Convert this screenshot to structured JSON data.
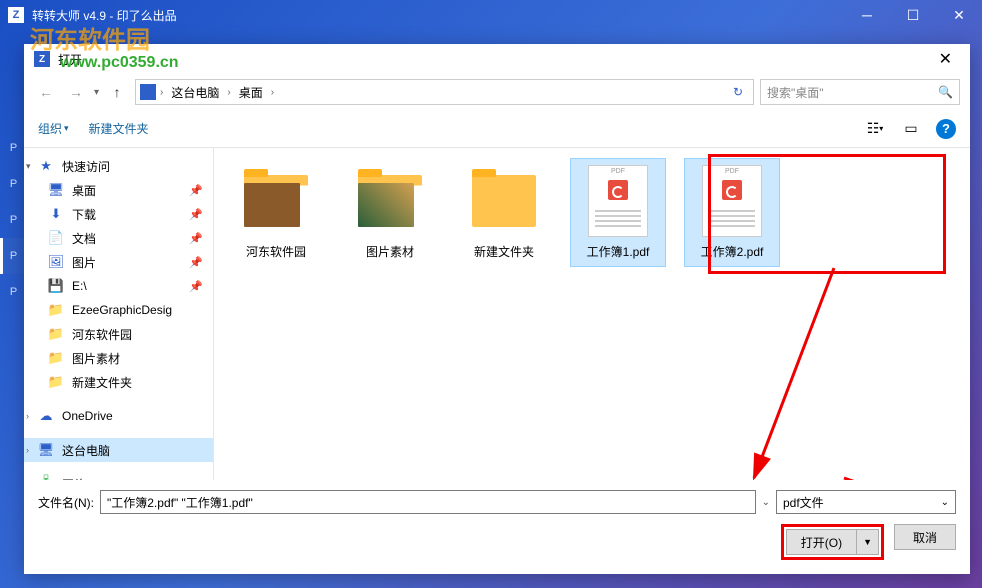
{
  "app": {
    "title": "转转大师 v4.9 - 印了么出品",
    "watermark": "河东软件园",
    "watermark_url": "www.pc0359.cn"
  },
  "left_strip": [
    "P",
    "P",
    "P",
    "P",
    "P"
  ],
  "dialog": {
    "title": "打开",
    "close": "✕",
    "nav": {
      "back": "←",
      "forward": "→",
      "up": "↑"
    },
    "path": {
      "seg1": "这台电脑",
      "seg2": "桌面",
      "refresh": "↻"
    },
    "search": {
      "placeholder": "搜索\"桌面\"",
      "icon": "🔍"
    },
    "toolbar": {
      "organize": "组织",
      "newfolder": "新建文件夹",
      "help": "?"
    },
    "sidebar": {
      "quick": "快速访问",
      "desktop": "桌面",
      "downloads": "下载",
      "documents": "文档",
      "pictures": "图片",
      "e_drive": "E:\\",
      "ezee": "EzeeGraphicDesig",
      "hedong": "河东软件园",
      "picmat": "图片素材",
      "newfolder": "新建文件夹",
      "onedrive": "OneDrive",
      "thispc": "这台电脑",
      "network": "网络"
    },
    "files": [
      {
        "name": "河东软件园",
        "type": "folder-img1"
      },
      {
        "name": "图片素材",
        "type": "folder-img2"
      },
      {
        "name": "新建文件夹",
        "type": "folder"
      },
      {
        "name": "工作簿1.pdf",
        "type": "pdf",
        "selected": true
      },
      {
        "name": "工作簿2.pdf",
        "type": "pdf",
        "selected": true
      }
    ],
    "filename_label": "文件名(N):",
    "filename_value": "\"工作簿2.pdf\" \"工作簿1.pdf\"",
    "filter": "pdf文件",
    "open_btn": "打开(O)",
    "cancel_btn": "取消"
  }
}
